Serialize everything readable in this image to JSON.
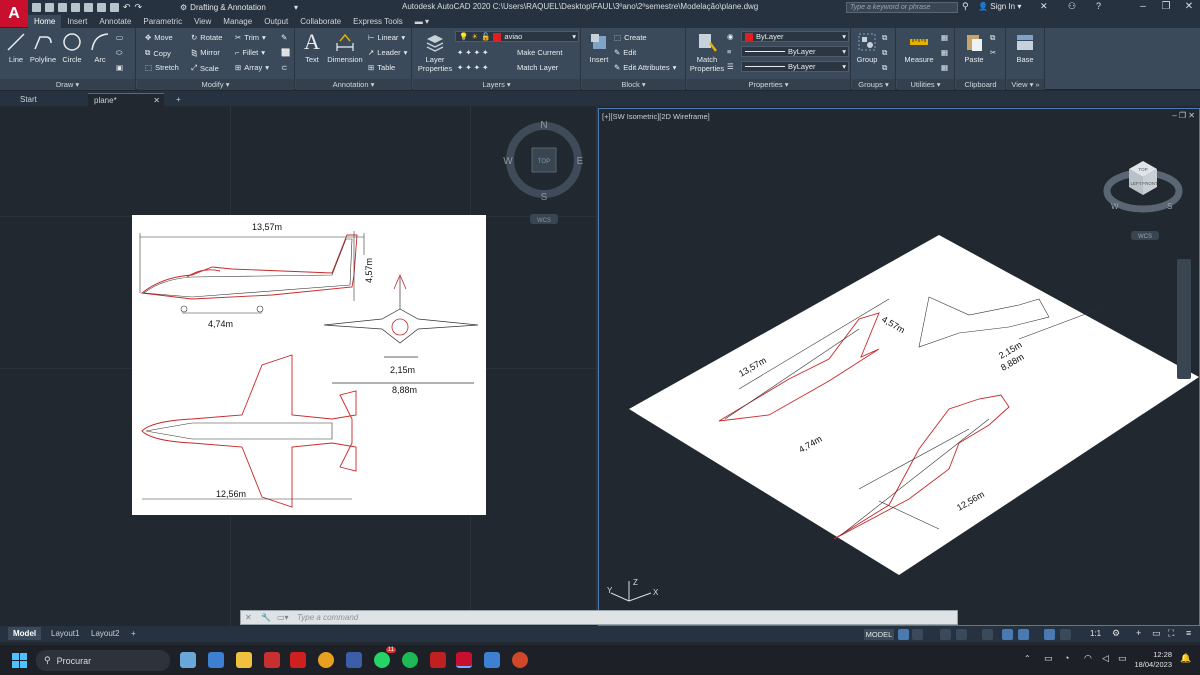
{
  "window": {
    "title": "Autodesk AutoCAD 2020    C:\\Users\\RAQUEL\\Desktop\\FAUL\\3ºano\\2ºsemestre\\Modelação\\plane.dwg",
    "workspace": "Drafting & Annotation",
    "search_placeholder": "Type a keyword or phrase",
    "sign_in": "Sign In",
    "app_letter": "A"
  },
  "ribbon_tabs": [
    "Home",
    "Insert",
    "Annotate",
    "Parametric",
    "View",
    "Manage",
    "Output",
    "Collaborate",
    "Express Tools"
  ],
  "ribbon": {
    "draw": {
      "title": "Draw",
      "line": "Line",
      "polyline": "Polyline",
      "circle": "Circle",
      "arc": "Arc"
    },
    "modify": {
      "title": "Modify",
      "move": "Move",
      "copy": "Copy",
      "stretch": "Stretch",
      "rotate": "Rotate",
      "mirror": "Mirror",
      "scale": "Scale",
      "trim": "Trim",
      "fillet": "Fillet",
      "array": "Array"
    },
    "annotation": {
      "title": "Annotation",
      "text": "Text",
      "dimension": "Dimension",
      "linear": "Linear",
      "leader": "Leader",
      "table": "Table"
    },
    "layers": {
      "title": "Layers",
      "layer_properties": "Layer Properties",
      "current_layer": "aviao",
      "make_current": "Make Current",
      "match_layer": "Match Layer",
      "layer_color": "#e02020"
    },
    "block": {
      "title": "Block",
      "insert": "Insert",
      "create": "Create",
      "edit": "Edit",
      "edit_attributes": "Edit Attributes"
    },
    "properties": {
      "title": "Properties",
      "match_properties": "Match Properties",
      "color": "ByLayer",
      "linetype": "ByLayer",
      "lineweight": "ByLayer"
    },
    "groups": {
      "title": "Groups",
      "group": "Group"
    },
    "utilities": {
      "title": "Utilities",
      "measure": "Measure"
    },
    "clipboard": {
      "title": "Clipboard",
      "paste": "Paste"
    },
    "view": {
      "title": "View",
      "base": "Base"
    }
  },
  "file_tabs": [
    "Start",
    "plane*"
  ],
  "viewports": {
    "left": {
      "compass": {
        "n": "N",
        "s": "S",
        "e": "E",
        "w": "W",
        "top": "TOP",
        "wcs": "WCS"
      }
    },
    "right": {
      "label": "[+][SW Isometric][2D Wireframe]",
      "cube": {
        "top": "TOP",
        "left": "LEFT",
        "front": "FRONT",
        "wcs": "WCS",
        "w": "W",
        "s": "S"
      }
    }
  },
  "drawing": {
    "dim_length": "13,57m",
    "dim_height": "4,57m",
    "dim_wheelbase": "4,74m",
    "dim_track": "2,15m",
    "dim_span_front": "8,88m",
    "dim_span_plan": "12,56m",
    "iso_length": "13,57m",
    "iso_height": "4,57m",
    "iso_wheelbase": "4,74m",
    "iso_track": "2,15m",
    "iso_span": "8,88m",
    "iso_span_plan": "12,56m"
  },
  "command": {
    "placeholder": "Type  a  command"
  },
  "layout_tabs": [
    "Model",
    "Layout1",
    "Layout2"
  ],
  "status": {
    "model": "MODEL",
    "scale": "1:1"
  },
  "taskbar": {
    "search": "Procurar",
    "time": "12:28",
    "date": "18/04/2023",
    "whatsapp_badge": "11"
  }
}
